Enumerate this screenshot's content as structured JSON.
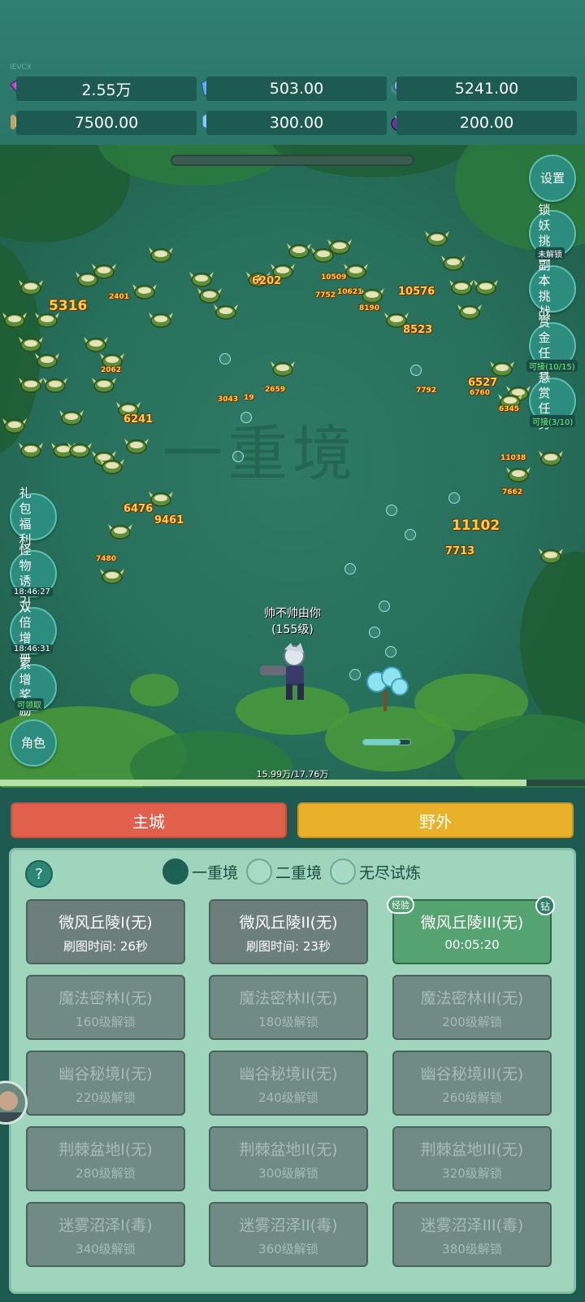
{
  "build_tag": "IEVCX",
  "resources": [
    {
      "icon": "purple-gem-icon",
      "value": "2.55万"
    },
    {
      "icon": "blue-crystal-icon",
      "value": "503.00"
    },
    {
      "icon": "orb-icon",
      "value": "5241.00"
    },
    {
      "icon": "scroll-icon",
      "value": "7500.00"
    },
    {
      "icon": "ice-crystal-icon",
      "value": "300.00"
    },
    {
      "icon": "purple-pot-icon",
      "value": "200.00"
    }
  ],
  "realm_watermark": "一重境",
  "right_buttons": [
    {
      "label": "设置",
      "sub": ""
    },
    {
      "label": "锁妖挑战",
      "sub": "未解锁"
    },
    {
      "label": "副本挑战",
      "sub": ""
    },
    {
      "label": "赏金任务",
      "sub": "可接(10/15)"
    },
    {
      "label": "悬赏任务",
      "sub": "可接(3/10)"
    }
  ],
  "left_buttons": [
    {
      "label": "礼包福利",
      "sub": ""
    },
    {
      "label": "怪物诱引",
      "sub": "18:46:27"
    },
    {
      "label": "双倍增益",
      "sub": "18:46:31"
    },
    {
      "label": "累增奖励",
      "sub": "可领取"
    },
    {
      "label": "角色",
      "sub": ""
    }
  ],
  "damage_numbers": [
    "5316",
    "2401",
    "6202",
    "10509",
    "7752",
    "10621",
    "10576",
    "8190",
    "8523",
    "2062",
    "6241",
    "3043",
    "19",
    "2659",
    "7792",
    "6527",
    "6760",
    "6345",
    "11038",
    "7662",
    "6476",
    "9461",
    "11102",
    "7713",
    "7480"
  ],
  "player": {
    "name": "帅不帅由你",
    "level": "(155级)"
  },
  "exp": {
    "text": "15.99万/17.76万",
    "fraction": 0.9
  },
  "skill_charge": 0.8,
  "tabs": {
    "main_city": "主城",
    "wild": "野外"
  },
  "help": "?",
  "realms": [
    {
      "label": "一重境",
      "selected": true
    },
    {
      "label": "二重境",
      "selected": false
    },
    {
      "label": "无尽试炼",
      "selected": false
    }
  ],
  "maps": [
    {
      "title": "微风丘陵I(无)",
      "sub": "刷图时间: 26秒",
      "state": "unlocked"
    },
    {
      "title": "微风丘陵II(无)",
      "sub": "刷图时间: 23秒",
      "state": "unlocked"
    },
    {
      "title": "微风丘陵III(无)",
      "sub": "00:05:20",
      "state": "active",
      "tag_left": "经验",
      "tag_right": "钻"
    },
    {
      "title": "魔法密林I(无)",
      "sub": "160级解锁",
      "state": "locked"
    },
    {
      "title": "魔法密林II(无)",
      "sub": "180级解锁",
      "state": "locked"
    },
    {
      "title": "魔法密林III(无)",
      "sub": "200级解锁",
      "state": "locked"
    },
    {
      "title": "幽谷秘境I(无)",
      "sub": "220级解锁",
      "state": "locked"
    },
    {
      "title": "幽谷秘境II(无)",
      "sub": "240级解锁",
      "state": "locked"
    },
    {
      "title": "幽谷秘境III(无)",
      "sub": "260级解锁",
      "state": "locked"
    },
    {
      "title": "荆棘盆地I(无)",
      "sub": "280级解锁",
      "state": "locked"
    },
    {
      "title": "荆棘盆地II(无)",
      "sub": "300级解锁",
      "state": "locked"
    },
    {
      "title": "荆棘盆地III(无)",
      "sub": "320级解锁",
      "state": "locked"
    },
    {
      "title": "迷雾沼泽I(毒)",
      "sub": "340级解锁",
      "state": "locked"
    },
    {
      "title": "迷雾沼泽II(毒)",
      "sub": "360级解锁",
      "state": "locked"
    },
    {
      "title": "迷雾沼泽III(毒)",
      "sub": "380级解锁",
      "state": "locked"
    }
  ]
}
